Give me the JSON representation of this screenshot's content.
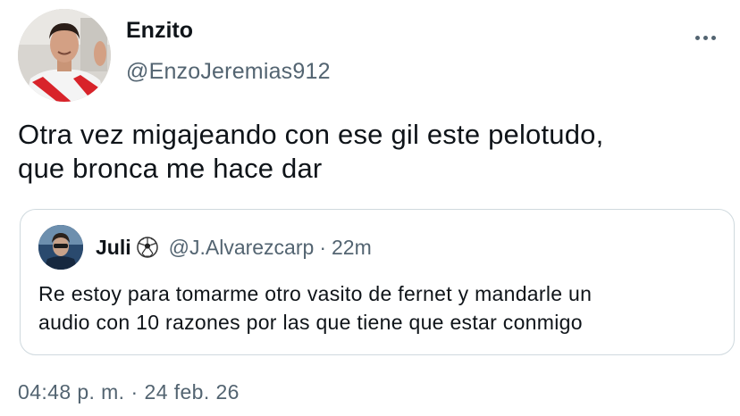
{
  "author": {
    "display_name": "Enzito",
    "handle": "@EnzoJeremias912",
    "avatar_icon": "profile-photo-avatar"
  },
  "more_icon": "more-horizontal-icon",
  "tweet": {
    "text_line1": "Otra vez migajeando con ese gil este pelotudo,",
    "text_line2": "que bronca me hace dar"
  },
  "quote": {
    "display_name": "Juli",
    "emoji_icon": "soccer-ball-icon",
    "handle": "@J.Alvarezcarp",
    "separator": "·",
    "time": "22m",
    "text_line1": "Re estoy para tomarme otro vasito de fernet y mandarle un",
    "text_line2": "audio con 10 razones por las que tiene que estar conmigo"
  },
  "timestamp": {
    "time": "04:48 p. m.",
    "separator": "·",
    "date": "24 feb. 26"
  },
  "colors": {
    "primary_text": "#0f1419",
    "secondary_text": "#536471",
    "border": "#cfd9de"
  }
}
